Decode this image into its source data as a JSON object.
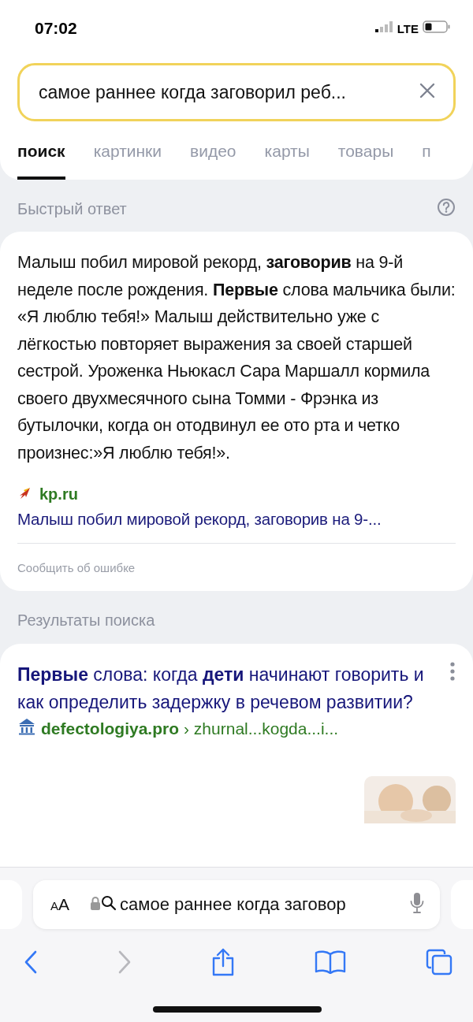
{
  "status_bar": {
    "time": "07:02",
    "network": "LTE"
  },
  "search": {
    "query": "самое раннее когда заговорил реб..."
  },
  "tabs": [
    {
      "label": "поиск",
      "selected": true
    },
    {
      "label": "картинки",
      "selected": false
    },
    {
      "label": "видео",
      "selected": false
    },
    {
      "label": "карты",
      "selected": false
    },
    {
      "label": "товары",
      "selected": false
    },
    {
      "label": "п",
      "selected": false
    }
  ],
  "quick_answer": {
    "heading": "Быстрый ответ",
    "text": "Малыш побил мировой рекорд, **заговорив** на 9-й неделе после рождения. **Первые** слова мальчика были: «Я люблю тебя!» Малыш действительно уже с лёгкостью повторяет выражения за своей старшей сестрой. Уроженка Ньюкасл Сара Маршалл кормила своего двухмесячного сына Томми - Фрэнка из бутылочки, когда он отодвинул ее ото рта и четко произнес:»Я люблю тебя!».",
    "source": "kp.ru",
    "link": "Малыш побил мировой рекорд, заговорив на 9-...",
    "report": "Сообщить об ошибке"
  },
  "results": {
    "heading": "Результаты поиска",
    "items": [
      {
        "title": "**Первые** слова: когда **дети** начинают говорить и как определить задержку в речевом развитии?",
        "domain": "defectologiya.pro",
        "path": "› zhurnal...kogda...i..."
      }
    ]
  },
  "browser": {
    "text_size": "AA",
    "address": "самое раннее когда заговор",
    "back_enabled": true,
    "forward_enabled": false
  }
}
